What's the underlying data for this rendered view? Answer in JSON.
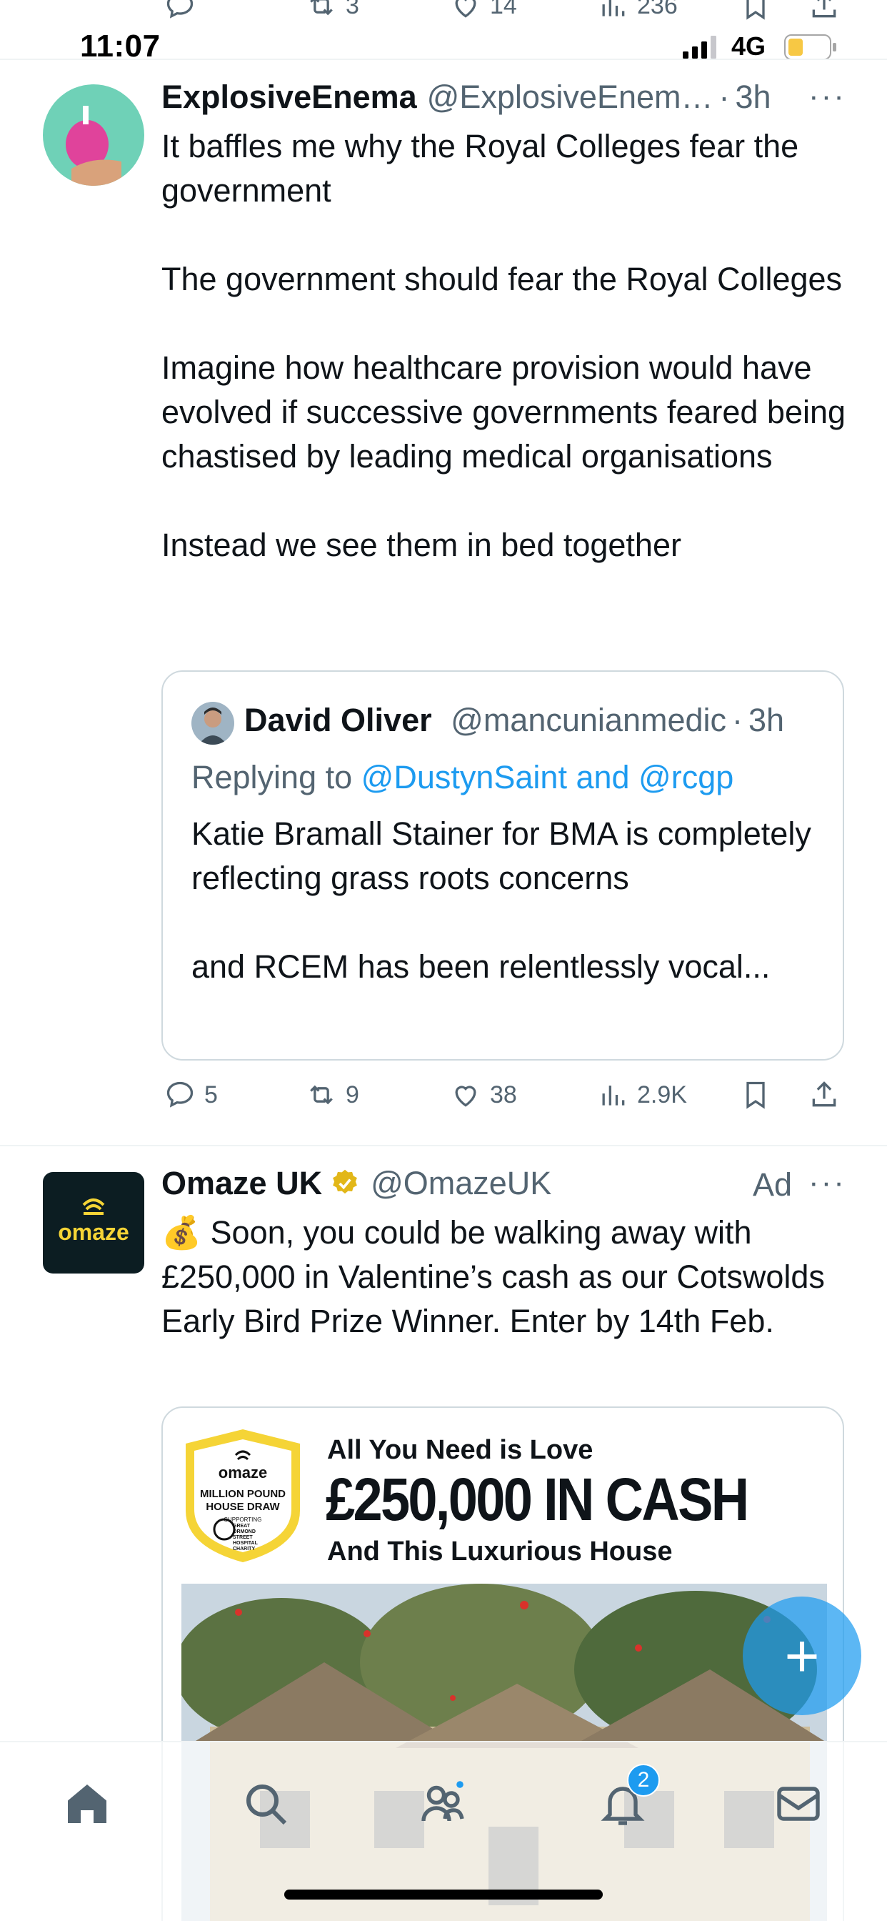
{
  "status_bar": {
    "time": "11:07",
    "network": "4G"
  },
  "previous_tweet_actions": {
    "retweets": "3",
    "likes": "14",
    "views": "236"
  },
  "tweet1": {
    "display_name": "ExplosiveEnema",
    "handle": "@ExplosiveEnem…",
    "time": "3h",
    "text": "It baffles me why the Royal Colleges fear the government\n\nThe government should fear the Royal Colleges\n\nImagine how healthcare provision would have evolved if successive governments feared being chastised by leading medical organisations\n\nInstead we see them in bed together",
    "quote": {
      "display_name": "David Oliver",
      "handle": "@mancunianmedic",
      "time": "3h",
      "replying_prefix": "Replying to",
      "replying_to": "@DustynSaint and @rcgp",
      "text": "Katie Bramall Stainer for BMA is completely reflecting grass roots concerns\n\nand RCEM has been relentlessly vocal..."
    },
    "actions": {
      "replies": "5",
      "retweets": "9",
      "likes": "38",
      "views": "2.9K"
    }
  },
  "tweet2": {
    "display_name": "Omaze UK",
    "handle": "@OmazeUK",
    "ad_label": "Ad",
    "avatar_text": "omaze",
    "text": "💰  Soon, you could be walking away with £250,000 in Valentine’s cash as our Cotswolds Early Bird Prize Winner. Enter by 14th Feb.",
    "card": {
      "line1": "All You Need is Love",
      "line2": "£250,000 IN CASH",
      "line3": "And This Luxurious House",
      "badge_brand": "omaze",
      "badge_title": "MILLION POUND HOUSE DRAW",
      "badge_sub": "SUPPORTING",
      "badge_charity": "GREAT ORMOND STREET HOSPITAL CHARITY"
    }
  },
  "bottom_nav": {
    "notifications_count": "2"
  },
  "colors": {
    "accent": "#1d9bf0",
    "secondary_text": "#536471",
    "verified_gold": "#e2b719",
    "omaze_bg": "#0c1d22",
    "omaze_yellow": "#f5d436"
  }
}
